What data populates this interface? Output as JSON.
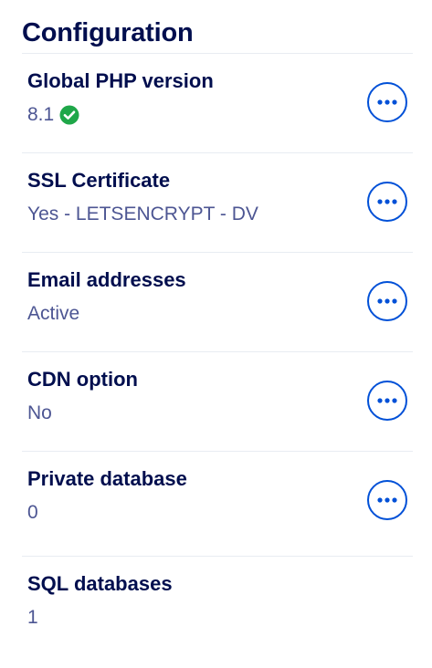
{
  "section": {
    "title": "Configuration"
  },
  "rows": [
    {
      "label": "Global PHP version",
      "value": "8.1",
      "has_menu": true,
      "status_icon": "check-circle-icon"
    },
    {
      "label": "SSL Certificate",
      "value": "Yes - LETSENCRYPT - DV",
      "has_menu": true
    },
    {
      "label": "Email addresses",
      "value": "Active",
      "has_menu": true
    },
    {
      "label": "CDN option",
      "value": "No",
      "has_menu": true
    },
    {
      "label": "Private database",
      "value": "0",
      "has_menu": true
    },
    {
      "label": "SQL databases",
      "value": "1",
      "has_menu": false
    }
  ],
  "colors": {
    "heading": "#000e4e",
    "value_text": "#4d5693",
    "accent": "#0050d7",
    "success": "#1fa749",
    "divider": "#e8ecf2"
  },
  "icons": {
    "menu": "ellipsis-icon",
    "status": "check-circle-icon"
  }
}
